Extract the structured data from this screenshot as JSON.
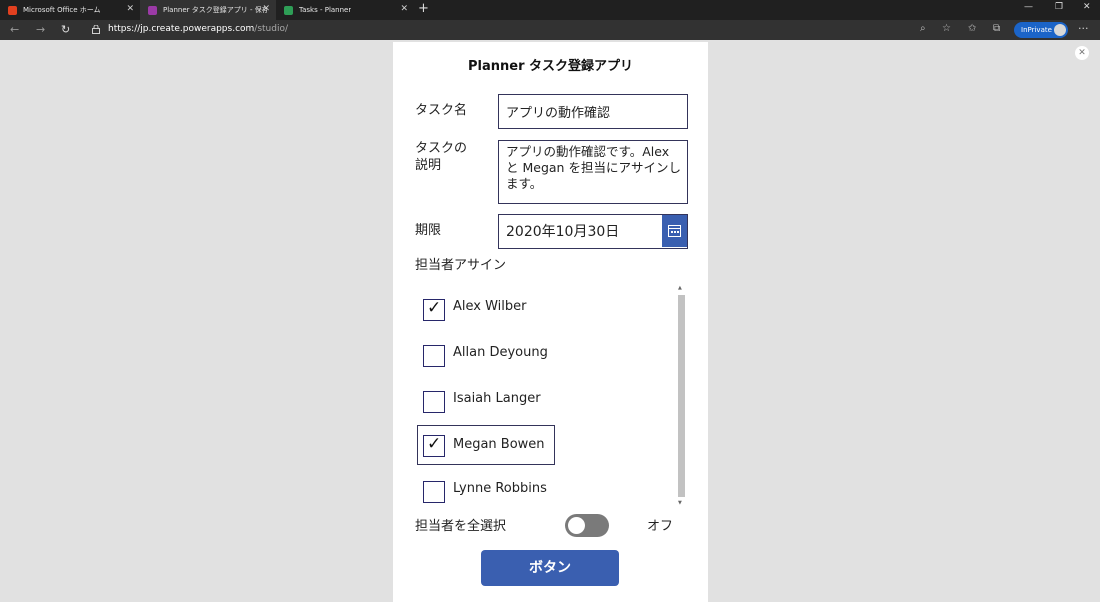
{
  "browser": {
    "tabs": [
      {
        "title": "Microsoft Office ホーム",
        "icon": "office-icon",
        "color": "#e2401f"
      },
      {
        "title": "Planner タスク登録アプリ - 保存済...",
        "icon": "powerapps-icon",
        "color": "#9b3aa6"
      },
      {
        "title": "Tasks - Planner",
        "icon": "planner-icon",
        "color": "#2e9e56"
      }
    ],
    "url_host": "https://jp.create.powerapps.com",
    "url_path": "/studio/",
    "inprivate_label": "InPrivate"
  },
  "app": {
    "title": "Planner タスク登録アプリ",
    "task_name_label": "タスク名",
    "task_name_value": "アプリの動作確認",
    "task_desc_label_line1": "タスクの",
    "task_desc_label_line2": "説明",
    "task_desc_value": "アプリの動作確認です。Alex と Megan を担当にアサインします。",
    "due_label": "期限",
    "due_value": "2020年10月30日",
    "assign_label": "担当者アサイン",
    "assignees": [
      {
        "name": "Alex Wilber",
        "checked": true,
        "selected": false
      },
      {
        "name": "Allan Deyoung",
        "checked": false,
        "selected": false
      },
      {
        "name": "Isaiah Langer",
        "checked": false,
        "selected": false
      },
      {
        "name": "Megan Bowen",
        "checked": true,
        "selected": true
      },
      {
        "name": "Lynne Robbins",
        "checked": false,
        "selected": false
      }
    ],
    "select_all_label": "担当者を全選択",
    "toggle_state_label": "オフ",
    "submit_label": "ボタン",
    "accent_color": "#3a5fb0",
    "border_color": "#34345a"
  }
}
